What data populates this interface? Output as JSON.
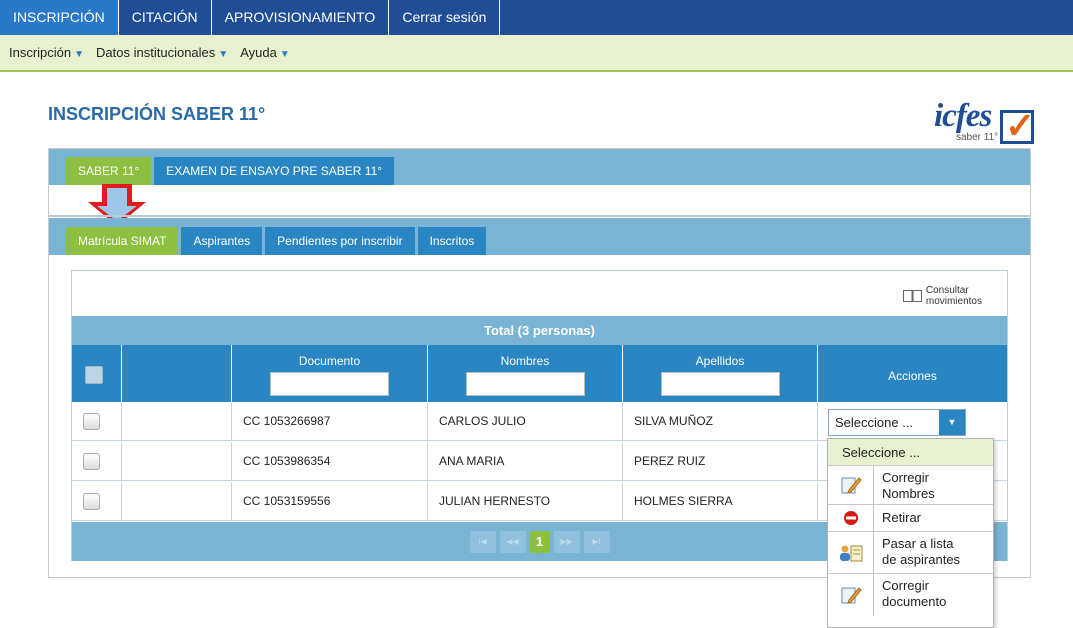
{
  "topnav": [
    "INSCRIPCIÓN",
    "CITACIÓN",
    "APROVISIONAMIENTO",
    "Cerrar sesión"
  ],
  "subnav": [
    "Inscripción",
    "Datos institucionales",
    "Ayuda"
  ],
  "page_title": "INSCRIPCIÓN SABER 11°",
  "logo": {
    "brand": "icfes",
    "sub": "saber 11°"
  },
  "exam_tabs": [
    "SABER 11°",
    "EXAMEN DE ENSAYO PRE SABER 11°"
  ],
  "sub_tabs": [
    "Matrícula SIMAT",
    "Aspirantes",
    "Pendientes por inscribir",
    "Inscritos"
  ],
  "consult": {
    "line1": "Consultar",
    "line2": "movimientos"
  },
  "table": {
    "total": "Total (3 personas)",
    "columns": [
      "Documento",
      "Nombres",
      "Apellidos",
      "Acciones"
    ],
    "rows": [
      {
        "doc": "CC 1053266987",
        "nombres": "CARLOS JULIO",
        "apellidos": "SILVA MUÑOZ"
      },
      {
        "doc": "CC 1053986354",
        "nombres": "ANA MARIA",
        "apellidos": "PEREZ RUIZ"
      },
      {
        "doc": "CC 1053159556",
        "nombres": "JULIAN HERNESTO",
        "apellidos": "HOLMES SIERRA"
      }
    ]
  },
  "pager": {
    "first": "I◀",
    "prev": "◀◀",
    "current": "1",
    "next": "▶▶",
    "last": "▶I"
  },
  "select": {
    "value": "Seleccione ..."
  },
  "dropdown": {
    "head": "Seleccione ...",
    "options": [
      {
        "line1": "Corregir",
        "line2": "Nombres",
        "icon": "edit-icon"
      },
      {
        "line1": "Retirar",
        "line2": "",
        "icon": "remove-icon"
      },
      {
        "line1": "Pasar a lista",
        "line2": "de aspirantes",
        "icon": "users-list-icon"
      },
      {
        "line1": "Corregir",
        "line2": "documento",
        "icon": "edit-icon"
      }
    ]
  }
}
